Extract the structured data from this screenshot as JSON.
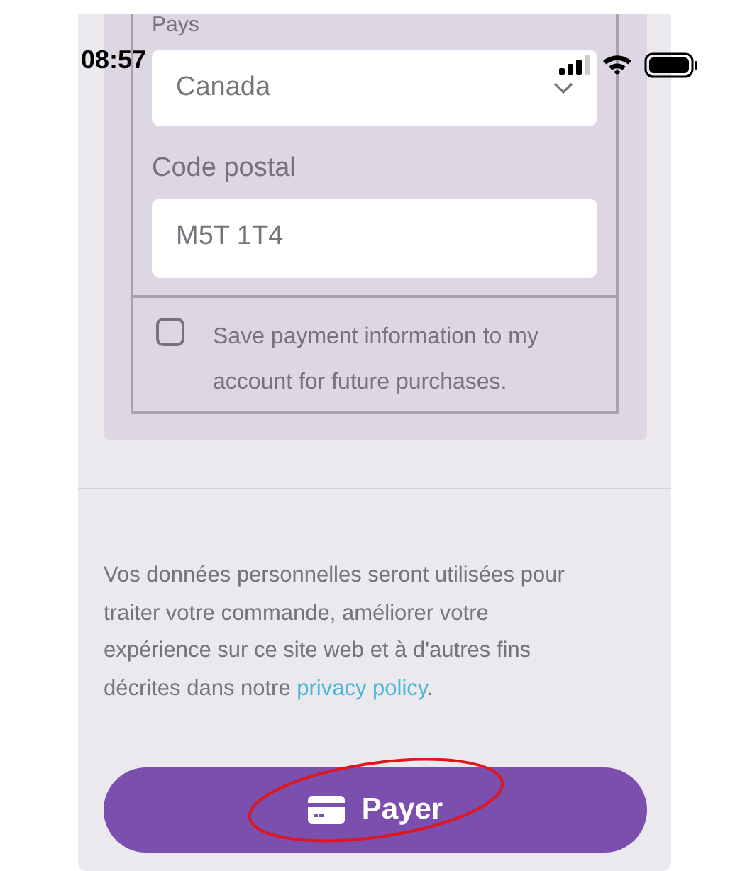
{
  "status_bar": {
    "time": "08:57"
  },
  "billing": {
    "country_label": "Pays",
    "country_value": "Canada",
    "postal_label": "Code postal",
    "postal_value": "M5T 1T4"
  },
  "save_payment": {
    "checked": false,
    "label": "Save payment information to my account for future purchases."
  },
  "privacy_notice": {
    "text": "Vos données personnelles seront utilisées pour traiter votre commande, améliorer votre expérience sur ce site web et à d'autres fins décrites dans notre",
    "link": "privacy policy",
    "suffix": "."
  },
  "pay_button": {
    "label": "Payer"
  }
}
